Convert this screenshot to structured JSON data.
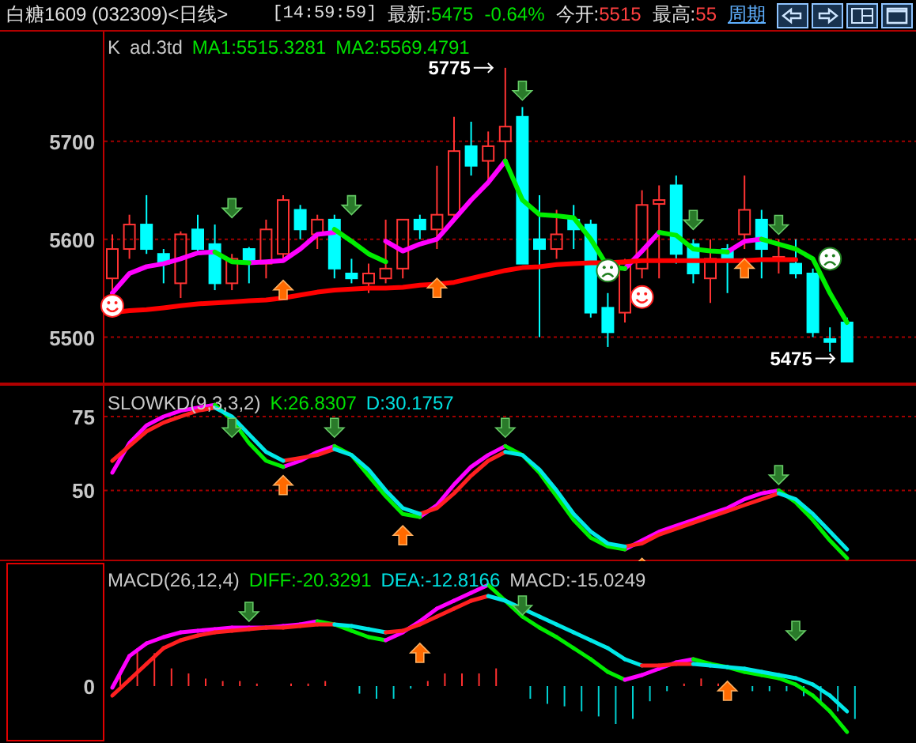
{
  "header": {
    "title": "白糖1609 (032309)<日线>",
    "time": "[14:59:59]",
    "quotes": [
      {
        "label": "最新:",
        "value": "5475",
        "color": "#00e000"
      },
      {
        "value": "-0.64%",
        "color": "#00e000"
      },
      {
        "label": "今开:",
        "value": "5515",
        "color": "#ff4040"
      },
      {
        "label": "最高:",
        "value": "55",
        "color": "#ff4040"
      }
    ],
    "period_link": "周期",
    "buttons": [
      {
        "kind": "prev"
      },
      {
        "kind": "next"
      },
      {
        "kind": "split"
      },
      {
        "kind": "maximize"
      }
    ]
  },
  "panels": [
    {
      "kind": "price",
      "selected": false,
      "legend": [
        {
          "text": "K",
          "color": "#c8c8c8"
        },
        {
          "text": "ad.3td",
          "color": "#c8c8c8"
        },
        {
          "text": "MA1:5515.3281",
          "color": "#00e000"
        },
        {
          "text": "MA2:5569.4791",
          "color": "#00e000"
        }
      ],
      "high_label": "5775",
      "low_label": "5475",
      "chart_data": {
        "type": "candlestick",
        "grid": true,
        "ylim": [
          5452,
          5812
        ],
        "yticks": [
          5500,
          5600,
          5700
        ],
        "ohlc": [
          [
            5560,
            5605,
            5545,
            5590
          ],
          [
            5590,
            5625,
            5580,
            5615
          ],
          [
            5615,
            5645,
            5585,
            5590
          ],
          [
            5585,
            5590,
            5555,
            5575
          ],
          [
            5555,
            5608,
            5540,
            5605
          ],
          [
            5610,
            5625,
            5585,
            5590
          ],
          [
            5595,
            5615,
            5548,
            5555
          ],
          [
            5555,
            5585,
            5548,
            5580
          ],
          [
            5590,
            5592,
            5555,
            5575
          ],
          [
            5575,
            5620,
            5560,
            5610
          ],
          [
            5585,
            5645,
            5580,
            5640
          ],
          [
            5630,
            5635,
            5600,
            5610
          ],
          [
            5605,
            5625,
            5590,
            5620
          ],
          [
            5620,
            5625,
            5560,
            5570
          ],
          [
            5565,
            5580,
            5555,
            5560
          ],
          [
            5555,
            5575,
            5545,
            5565
          ],
          [
            5560,
            5620,
            5555,
            5570
          ],
          [
            5570,
            5620,
            5560,
            5620
          ],
          [
            5620,
            5625,
            5600,
            5610
          ],
          [
            5610,
            5675,
            5590,
            5625
          ],
          [
            5625,
            5725,
            5620,
            5690
          ],
          [
            5695,
            5720,
            5665,
            5675
          ],
          [
            5680,
            5710,
            5660,
            5695
          ],
          [
            5700,
            5775,
            5680,
            5715
          ],
          [
            5725,
            5735,
            5575,
            5575
          ],
          [
            5600,
            5645,
            5500,
            5590
          ],
          [
            5590,
            5630,
            5580,
            5605
          ],
          [
            5620,
            5635,
            5590,
            5610
          ],
          [
            5615,
            5620,
            5520,
            5525
          ],
          [
            5530,
            5545,
            5490,
            5505
          ],
          [
            5525,
            5580,
            5515,
            5575
          ],
          [
            5570,
            5650,
            5560,
            5635
          ],
          [
            5636,
            5655,
            5560,
            5640
          ],
          [
            5655,
            5665,
            5575,
            5585
          ],
          [
            5595,
            5600,
            5555,
            5565
          ],
          [
            5560,
            5600,
            5535,
            5580
          ],
          [
            5590,
            5595,
            5545,
            5580
          ],
          [
            5605,
            5665,
            5590,
            5630
          ],
          [
            5620,
            5630,
            5560,
            5590
          ],
          [
            5580,
            5600,
            5565,
            5582
          ],
          [
            5575,
            5600,
            5560,
            5565
          ],
          [
            5565,
            5570,
            5500,
            5505
          ],
          [
            5498,
            5510,
            5485,
            5495
          ],
          [
            5515,
            5520,
            5475,
            5475
          ]
        ]
      }
    },
    {
      "kind": "oscillator",
      "selected": false,
      "legend": [
        {
          "text": "SLOWKD(9,3,3,2)",
          "color": "#c8c8c8"
        },
        {
          "text": "K:26.8307",
          "color": "#00e000"
        },
        {
          "text": "D:30.1757",
          "color": "#00e0e0"
        }
      ],
      "chart_data": {
        "type": "line",
        "grid": true,
        "ylim": [
          26,
          86
        ],
        "yticks": [
          50,
          75
        ],
        "series": [
          {
            "color": "#ff00ff",
            "values": [
              56,
              66,
              72,
              75,
              77,
              78,
              79,
              null,
              null,
              null,
              58,
              60,
              63,
              65,
              null,
              null,
              null,
              null,
              41,
              45,
              52,
              58,
              62,
              65,
              null,
              null,
              null,
              null,
              null,
              null,
              30,
              33,
              36,
              38,
              40,
              42,
              44,
              47,
              49,
              50,
              null,
              null,
              null,
              null
            ]
          },
          {
            "color": "#00ee00",
            "values": [
              null,
              null,
              null,
              null,
              null,
              null,
              79,
              74,
              66,
              60,
              58,
              null,
              null,
              65,
              62,
              55,
              48,
              42,
              41,
              null,
              null,
              null,
              null,
              65,
              62,
              56,
              48,
              40,
              34,
              31,
              30,
              null,
              null,
              null,
              null,
              null,
              null,
              null,
              null,
              50,
              46,
              40,
              33,
              27
            ]
          },
          {
            "color": "#ff2020",
            "values": [
              60,
              65,
              70,
              73,
              75,
              77,
              78,
              null,
              null,
              null,
              60,
              61,
              62,
              64,
              null,
              null,
              null,
              null,
              42,
              44,
              49,
              55,
              60,
              63,
              null,
              null,
              null,
              null,
              null,
              null,
              31,
              32,
              35,
              37,
              39,
              41,
              43,
              45,
              47,
              49,
              null,
              null,
              null,
              null
            ]
          },
          {
            "color": "#00e8e8",
            "values": [
              null,
              null,
              null,
              null,
              null,
              null,
              78,
              75,
              69,
              63,
              60,
              null,
              null,
              64,
              62,
              57,
              50,
              44,
              42,
              null,
              null,
              null,
              null,
              63,
              62,
              57,
              50,
              42,
              36,
              32,
              31,
              null,
              null,
              null,
              null,
              null,
              null,
              null,
              null,
              49,
              47,
              42,
              36,
              30
            ]
          }
        ]
      }
    },
    {
      "kind": "macd",
      "selected": true,
      "legend": [
        {
          "text": "MACD(26,12,4)",
          "color": "#c8c8c8"
        },
        {
          "text": "DIFF:-20.3291",
          "color": "#00e000"
        },
        {
          "text": "DEA:-12.8166",
          "color": "#00e0e0"
        },
        {
          "text": "MACD:-15.0249",
          "color": "#c8c8c8"
        }
      ],
      "zero_label": "0"
    }
  ]
}
